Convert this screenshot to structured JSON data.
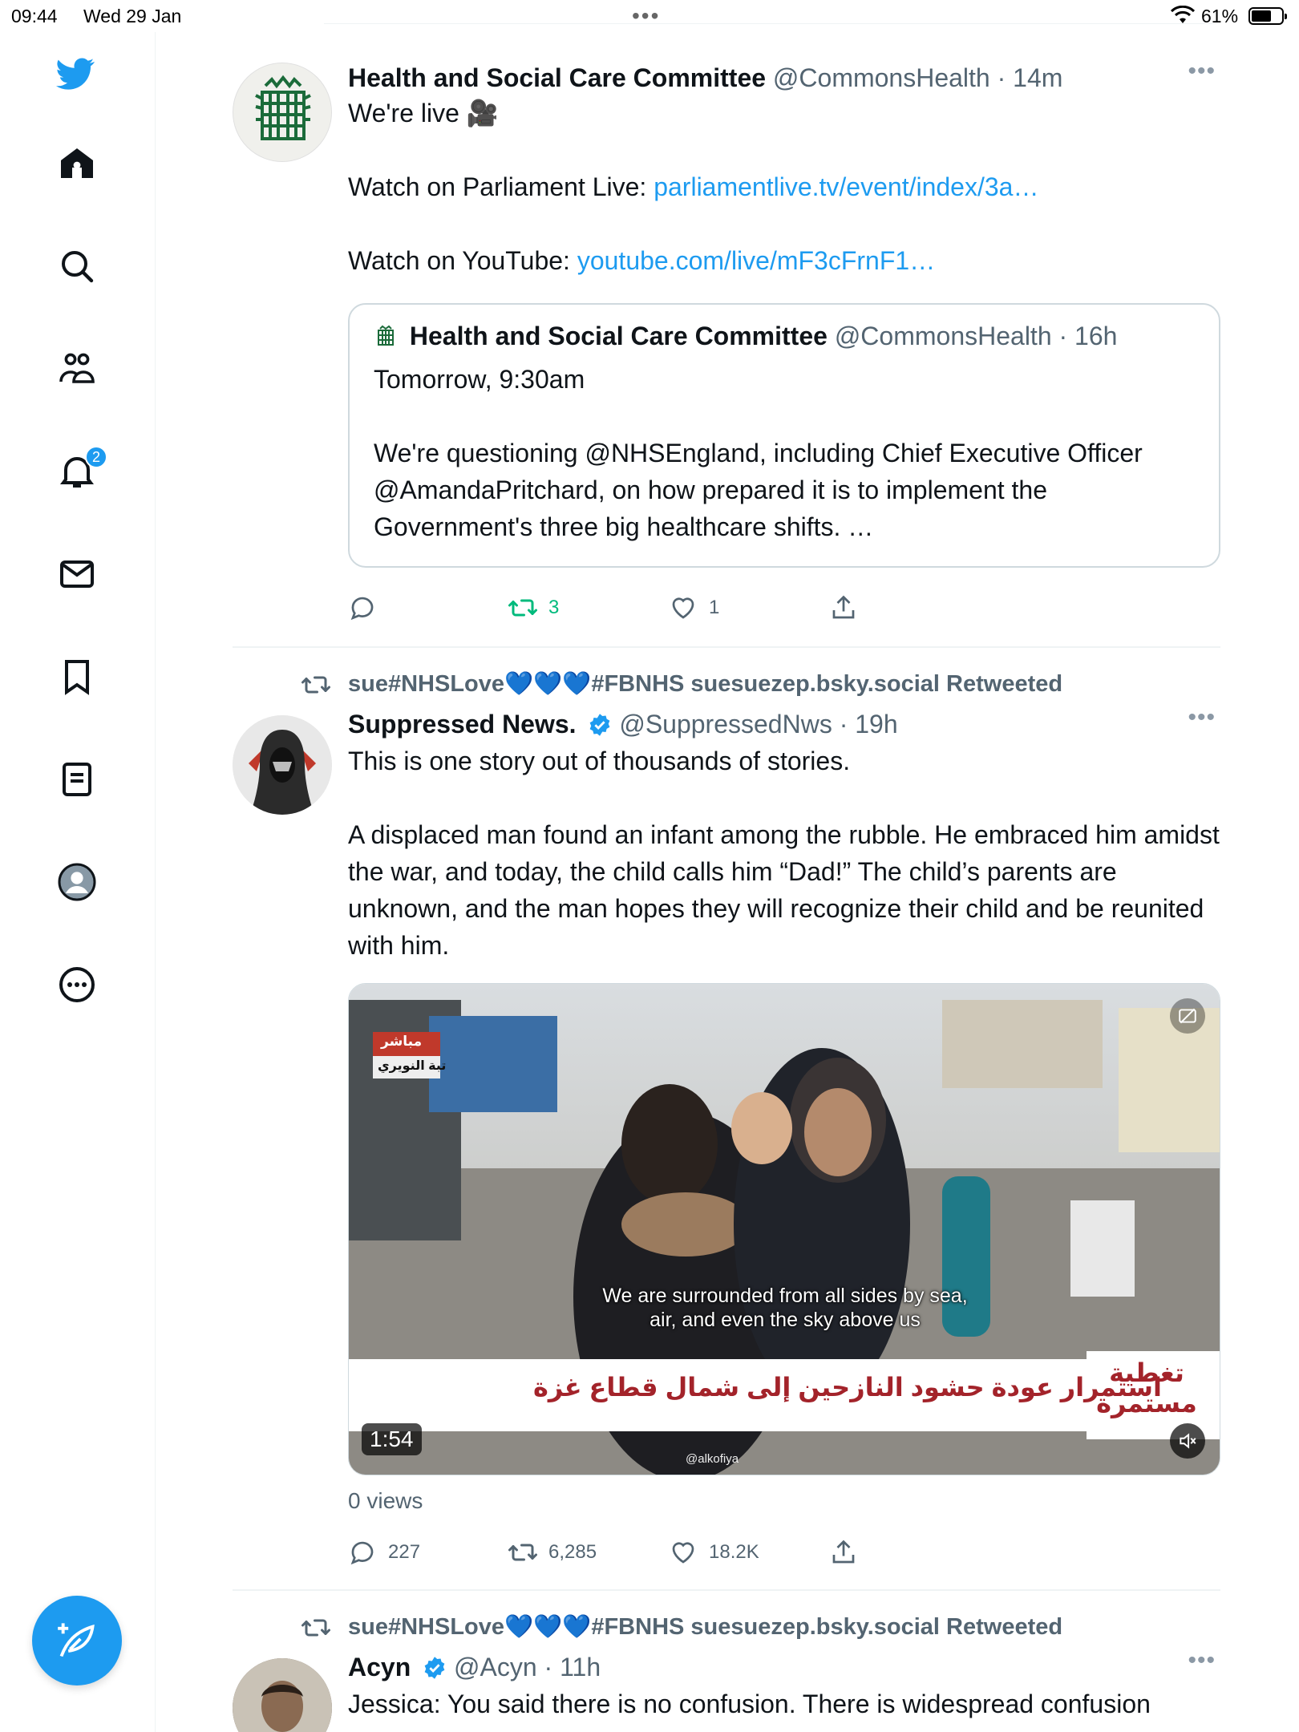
{
  "status_bar": {
    "time": "09:44",
    "date": "Wed 29 Jan",
    "battery": "61%",
    "battery_level": 0.61
  },
  "sidebar": {
    "notification_count": "2"
  },
  "tweets": [
    {
      "name": "Health and Social Care Committee",
      "handle": "@CommonsHealth",
      "time": "· 14m",
      "line1": "We're live 🎥",
      "line2_prefix": "Watch on Parliament Live: ",
      "line2_link": "parliamentlive.tv/event/index/3a…",
      "line3_prefix": "Watch on YouTube: ",
      "line3_link": "youtube.com/live/mF3cFrnF1…",
      "quote": {
        "name": "Health and Social Care Committee",
        "handle": "@CommonsHealth",
        "time": "· 16h",
        "line1": "Tomorrow, 9:30am",
        "line2": "We're questioning @NHSEngland, including Chief Executive Officer @AmandaPritchard, on how prepared it is to implement the Government's three big healthcare shifts. …"
      },
      "replies": "",
      "retweets": "3",
      "likes": "1"
    },
    {
      "retweeted_by": "sue#NHSLove💙💙💙#FBNHS suesuezep.bsky.social Retweeted",
      "name": "Suppressed News.",
      "handle": "@SuppressedNws",
      "time": "· 19h",
      "line1": "This is one story out of thousands of stories.",
      "line2": "A displaced man found an infant among the rubble. He embraced him amidst the war, and today, the child calls him “Dad!” The child’s parents are unknown, and the man hopes they will recognize their child and be reunited with him.",
      "video": {
        "subtitle_1": "We are surrounded from all sides  by sea,",
        "subtitle_2": "air, and even the sky above us",
        "ticker": "استمرار عودة حشود النازحين إلى شمال قطاع غزة",
        "ticker_label": "تغطية مستمرة",
        "live_badge": "مباشر",
        "location_badge": "تبة النويري",
        "watermark": "@alkofiya",
        "duration": "1:54"
      },
      "views": "0 views",
      "replies": "227",
      "retweets": "6,285",
      "likes": "18.2K"
    },
    {
      "retweeted_by": "sue#NHSLove💙💙💙#FBNHS suesuezep.bsky.social Retweeted",
      "name": "Acyn",
      "handle": "@Acyn",
      "time": "· 11h",
      "line1": "Jessica: You said there is no confusion. There is widespread confusion"
    }
  ],
  "colors": {
    "accent": "#1d9bf0",
    "retweet_green": "#00ba7c",
    "secondary_text": "#536471",
    "border": "#eff3f4"
  },
  "icons": [
    "twitter-logo-icon",
    "home-icon",
    "search-icon",
    "communities-icon",
    "notifications-icon",
    "messages-icon",
    "bookmarks-icon",
    "lists-icon",
    "profile-icon",
    "more-icon",
    "compose-icon",
    "reply-icon",
    "retweet-icon",
    "like-icon",
    "share-icon",
    "verified-icon",
    "mute-icon",
    "video-settings-icon"
  ]
}
